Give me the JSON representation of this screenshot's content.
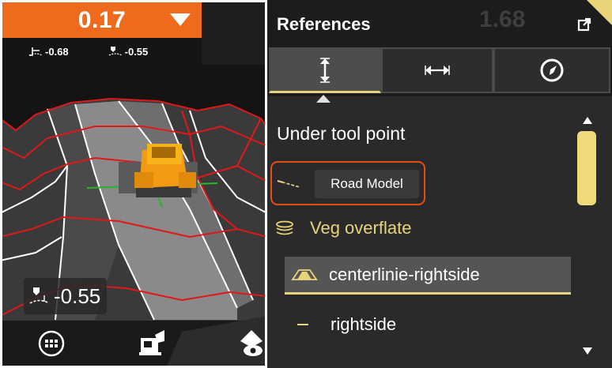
{
  "machine_view": {
    "elevation_value": "0.17",
    "left_offset": "-0.68",
    "right_offset": "-0.55",
    "bottom_readout": "-0.55"
  },
  "panel": {
    "title": "References",
    "ghost_value": "1.68",
    "tabs": [
      {
        "icon": "vertical-arrow-icon",
        "active": true
      },
      {
        "icon": "horizontal-arrow-icon",
        "active": false
      },
      {
        "icon": "compass-icon",
        "active": false
      }
    ],
    "section_title": "Under tool point",
    "items": [
      {
        "label": "Road Model",
        "icon": "road-model-icon"
      },
      {
        "label": "Veg overflate",
        "icon": "layers-icon"
      },
      {
        "label": "centerlinie-rightside",
        "icon": "surface-icon",
        "selected": true
      },
      {
        "label": "rightside",
        "icon": "line-icon"
      }
    ]
  },
  "colors": {
    "accent_orange": "#ee6a1c",
    "accent_yellow": "#e8d47a",
    "highlight_red": "#e34d16",
    "panel_bg": "#2a2a2a"
  }
}
